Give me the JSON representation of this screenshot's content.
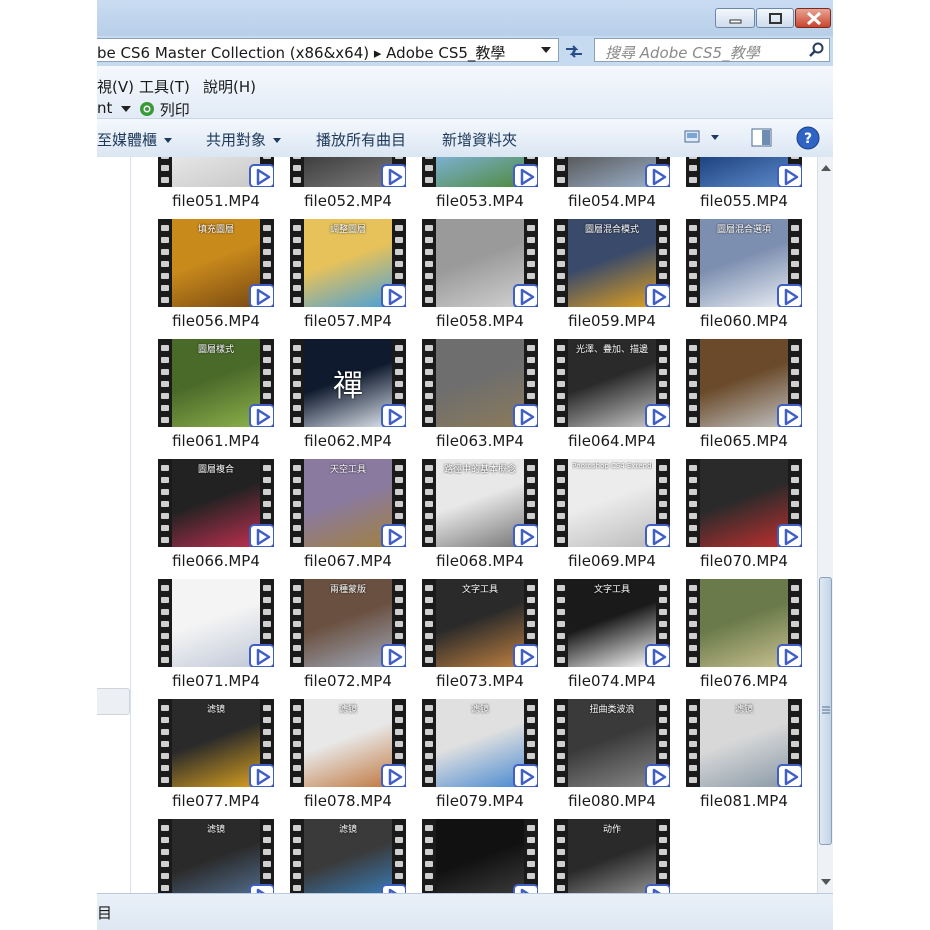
{
  "window": {
    "address_path": "be CS6 Master Collection (x86&x64)  ▸  Adobe CS5_教學",
    "search_placeholder": "搜尋 Adobe CS5_教學"
  },
  "menubar": {
    "items": [
      "視(V)",
      "工具(T)",
      "說明(H)"
    ],
    "row2_left": "nt",
    "print_label": "列印"
  },
  "toolbar": {
    "library_label": "至媒體櫃",
    "share_label": "共用對象",
    "play_all_label": "播放所有曲目",
    "new_folder_label": "新增資料夾"
  },
  "files": [
    {
      "name": "file051.MP4",
      "title": ""
    },
    {
      "name": "file052.MP4",
      "title": ""
    },
    {
      "name": "file053.MP4",
      "title": ""
    },
    {
      "name": "file054.MP4",
      "title": ""
    },
    {
      "name": "file055.MP4",
      "title": ""
    },
    {
      "name": "file056.MP4",
      "title": "填充圖層"
    },
    {
      "name": "file057.MP4",
      "title": "調整圖層"
    },
    {
      "name": "file058.MP4",
      "title": ""
    },
    {
      "name": "file059.MP4",
      "title": "圖層混合模式"
    },
    {
      "name": "file060.MP4",
      "title": "圖層混合選項"
    },
    {
      "name": "file061.MP4",
      "title": "圖層樣式"
    },
    {
      "name": "file062.MP4",
      "title": "禪"
    },
    {
      "name": "file063.MP4",
      "title": ""
    },
    {
      "name": "file064.MP4",
      "title": "光澤、疊加、描邊"
    },
    {
      "name": "file065.MP4",
      "title": ""
    },
    {
      "name": "file066.MP4",
      "title": "圖層複合"
    },
    {
      "name": "file067.MP4",
      "title": "天空工具"
    },
    {
      "name": "file068.MP4",
      "title": "路徑中的基本概念"
    },
    {
      "name": "file069.MP4",
      "title": "Photoshop CS4 Extended"
    },
    {
      "name": "file070.MP4",
      "title": ""
    },
    {
      "name": "file071.MP4",
      "title": ""
    },
    {
      "name": "file072.MP4",
      "title": "兩種蒙版"
    },
    {
      "name": "file073.MP4",
      "title": "文字工具"
    },
    {
      "name": "file074.MP4",
      "title": "文字工具"
    },
    {
      "name": "file076.MP4",
      "title": ""
    },
    {
      "name": "file077.MP4",
      "title": "滤镜"
    },
    {
      "name": "file078.MP4",
      "title": "滤镜"
    },
    {
      "name": "file079.MP4",
      "title": "滤镜"
    },
    {
      "name": "file080.MP4",
      "title": "扭曲类波浪"
    },
    {
      "name": "file081.MP4",
      "title": "滤镜"
    },
    {
      "name": "",
      "title": "滤镜"
    },
    {
      "name": "",
      "title": "滤镜"
    },
    {
      "name": "",
      "title": ""
    },
    {
      "name": "",
      "title": "动作"
    }
  ],
  "status": {
    "text": "目"
  },
  "colors": {
    "title_bar": "#c9dcf2",
    "toolbar": "#e6eef8",
    "play_badge": "#3f5fc7",
    "close_button": "#c9462e"
  }
}
